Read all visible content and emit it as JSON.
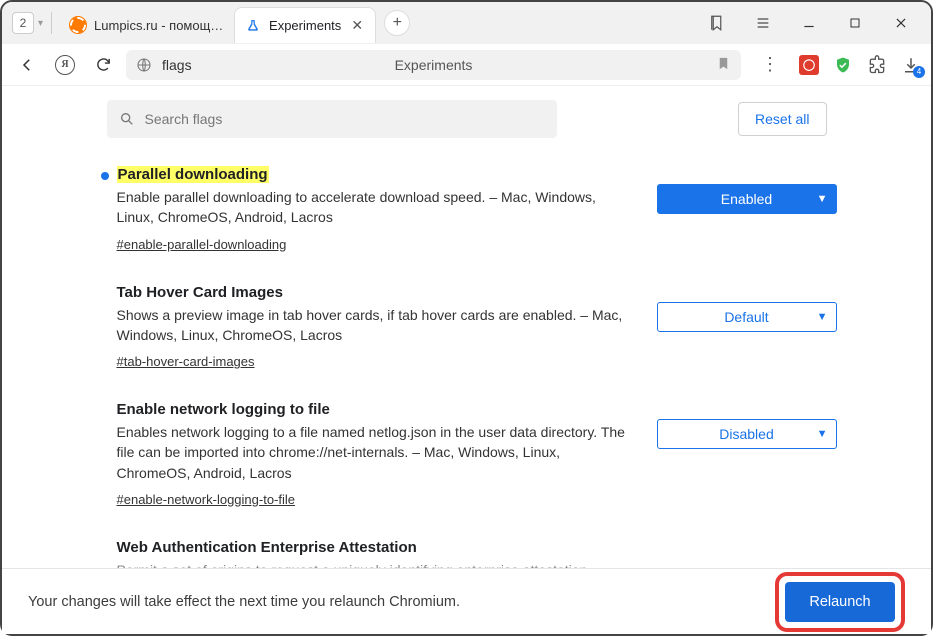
{
  "tabbar": {
    "tab_count": "2",
    "tabs": [
      {
        "title": "Lumpics.ru - помощь с ко",
        "active": false
      },
      {
        "title": "Experiments",
        "active": true
      }
    ]
  },
  "addressbar": {
    "url": "flags",
    "page_title": "Experiments",
    "downloads_badge": "4"
  },
  "page": {
    "search_placeholder": "Search flags",
    "reset_all": "Reset all"
  },
  "flags": [
    {
      "title": "Parallel downloading",
      "description": "Enable parallel downloading to accelerate download speed. – Mac, Windows, Linux, ChromeOS, Android, Lacros",
      "anchor": "#enable-parallel-downloading",
      "state": "Enabled",
      "changed": true
    },
    {
      "title": "Tab Hover Card Images",
      "description": "Shows a preview image in tab hover cards, if tab hover cards are enabled. – Mac, Windows, Linux, ChromeOS, Lacros",
      "anchor": "#tab-hover-card-images",
      "state": "Default",
      "changed": false
    },
    {
      "title": "Enable network logging to file",
      "description": "Enables network logging to a file named netlog.json in the user data directory. The file can be imported into chrome://net-internals. – Mac, Windows, Linux, ChromeOS, Android, Lacros",
      "anchor": "#enable-network-logging-to-file",
      "state": "Disabled",
      "changed": false
    },
    {
      "title": "Web Authentication Enterprise Attestation",
      "description": "Permit a set of origins to request a uniquely identifying enterprise attestation statement from",
      "anchor": "",
      "state": "",
      "changed": false
    }
  ],
  "footer": {
    "message": "Your changes will take effect the next time you relaunch Chromium.",
    "button": "Relaunch"
  }
}
